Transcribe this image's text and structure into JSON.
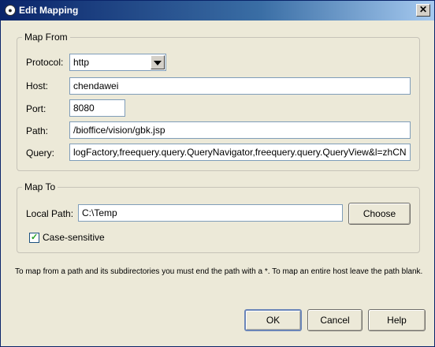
{
  "window": {
    "title": "Edit Mapping",
    "close_glyph": "✕"
  },
  "map_from": {
    "legend": "Map From",
    "protocol_label": "Protocol:",
    "protocol_value": "http",
    "host_label": "Host:",
    "host_value": "chendawei",
    "port_label": "Port:",
    "port_value": "8080",
    "path_label": "Path:",
    "path_value": "/bioffice/vision/gbk.jsp",
    "query_label": "Query:",
    "query_value": "logFactory,freequery.query.QueryNavigator,freequery.query.QueryView&l=zhCN"
  },
  "map_to": {
    "legend": "Map To",
    "local_path_label": "Local Path:",
    "local_path_value": "C:\\Temp",
    "choose_label": "Choose",
    "case_sensitive_label": "Case-sensitive",
    "case_sensitive_checked": true
  },
  "hint_text": "To map from a path and its subdirectories you must end the path with a *. To map an entire host leave the path blank.",
  "buttons": {
    "ok": "OK",
    "cancel": "Cancel",
    "help": "Help"
  },
  "icons": {
    "window_icon": "app-icon",
    "close": "close-icon",
    "dropdown": "chevron-down-icon",
    "check": "checkmark-icon"
  }
}
